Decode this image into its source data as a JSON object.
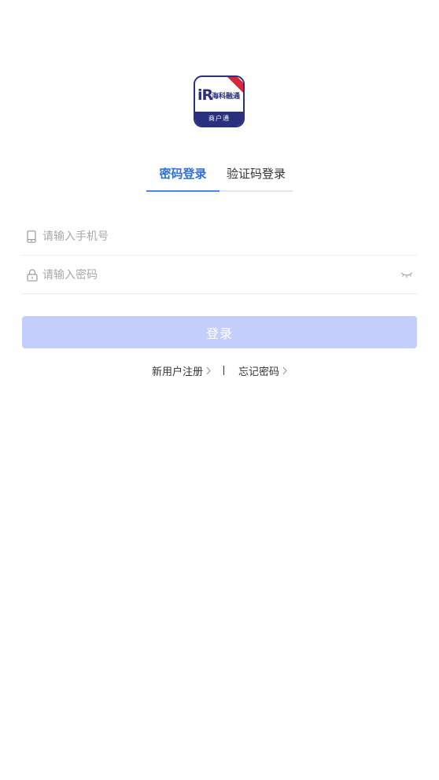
{
  "logo": {
    "mark": "iR",
    "name": "海科融通",
    "subtitle": "商户通"
  },
  "tabs": [
    {
      "label": "密码登录",
      "active": true
    },
    {
      "label": "验证码登录",
      "active": false
    }
  ],
  "form": {
    "phone_placeholder": "请输入手机号",
    "password_placeholder": "请输入密码",
    "login_label": "登录"
  },
  "links": {
    "register": "新用户注册",
    "forgot": "忘记密码"
  },
  "colors": {
    "accent": "#2f6fe0",
    "button_disabled": "#c3cefb",
    "brand_navy": "#2a2f7e",
    "brand_red": "#d8263a"
  },
  "icons": {
    "phone": "phone-icon",
    "lock": "lock-icon",
    "eye": "eye-closed-icon",
    "chevron": "chevron-right-icon"
  }
}
